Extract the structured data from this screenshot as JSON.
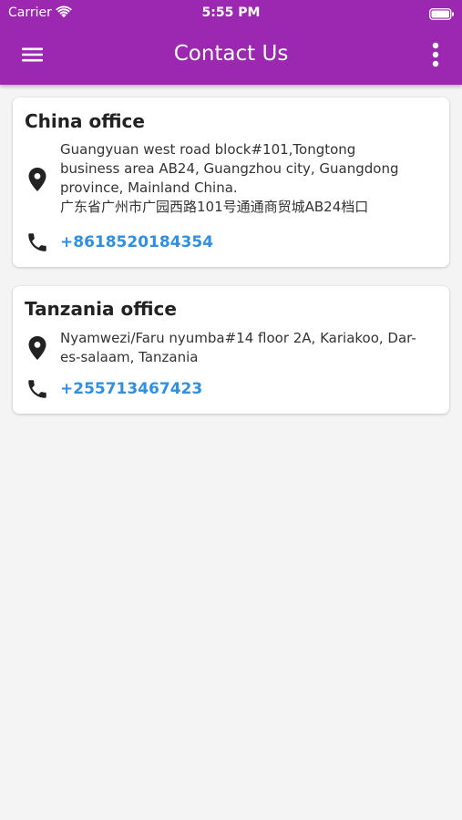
{
  "status_bar": {
    "carrier": "Carrier",
    "time": "5:55 PM"
  },
  "header": {
    "title": "Contact Us",
    "menu_icon": "hamburger-menu-icon",
    "more_icon": "more-vertical-icon"
  },
  "offices": [
    {
      "name": "China office",
      "address": "Guangyuan west road block#101,Tongtong\nbusiness area AB24, Guangzhou city, Guangdong\nprovince, Mainland China.\n广东省广州市广园西路101号通通商贸城AB24档口",
      "phone": "+8618520184354"
    },
    {
      "name": "Tanzania office",
      "address": "Nyamwezi/Faru nyumba#14 floor 2A, Kariakoo, Dar-\nes-salaam, Tanzania",
      "phone": "+255713467423"
    }
  ],
  "colors": {
    "app_bar": "#9c27b0",
    "background": "#f4f4f4",
    "phone_link": "#2f8fe0",
    "icon": "#222222"
  },
  "icons": {
    "location": "location-pin-icon",
    "phone": "phone-icon"
  }
}
